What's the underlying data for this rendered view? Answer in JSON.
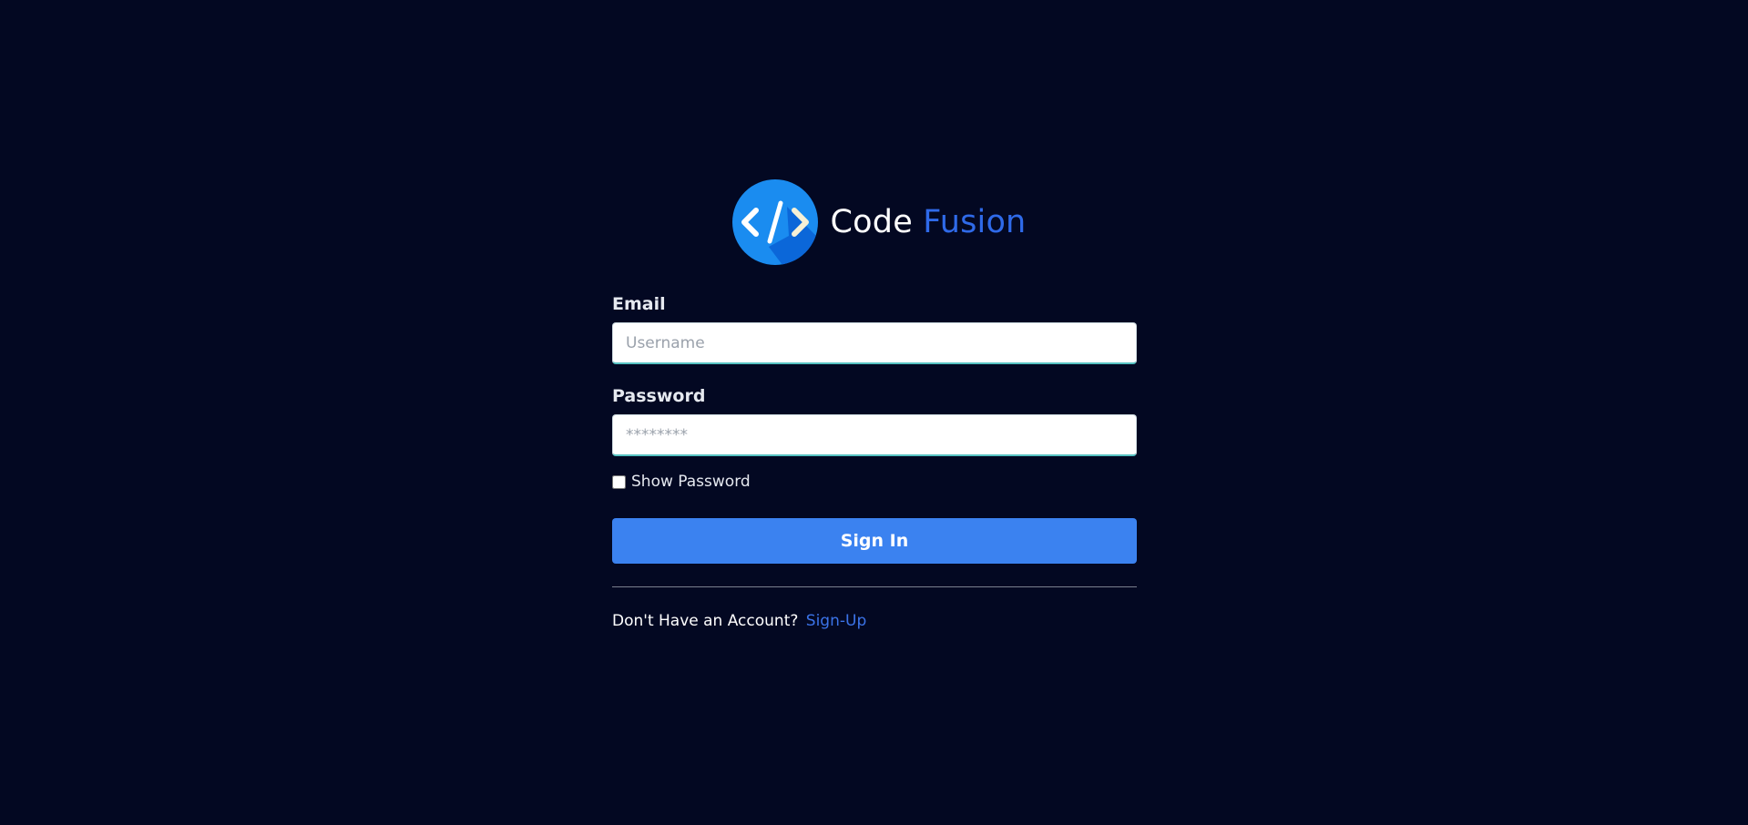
{
  "brand": {
    "name_part1": "Code",
    "name_part2": "Fusion",
    "logo_icon": "code-brackets-icon",
    "accent_color": "#2f6ae9"
  },
  "form": {
    "email_label": "Email",
    "email_placeholder": "Username",
    "email_value": "",
    "password_label": "Password",
    "password_placeholder": "********",
    "password_value": "",
    "show_password_label": "Show Password",
    "show_password_checked": false,
    "signin_label": "Sign In"
  },
  "footer": {
    "prompt_text": "Don't Have an Account?",
    "signup_link": "Sign-Up"
  },
  "colors": {
    "background": "#030822",
    "button": "#3b82f0",
    "link": "#3b73e8"
  }
}
